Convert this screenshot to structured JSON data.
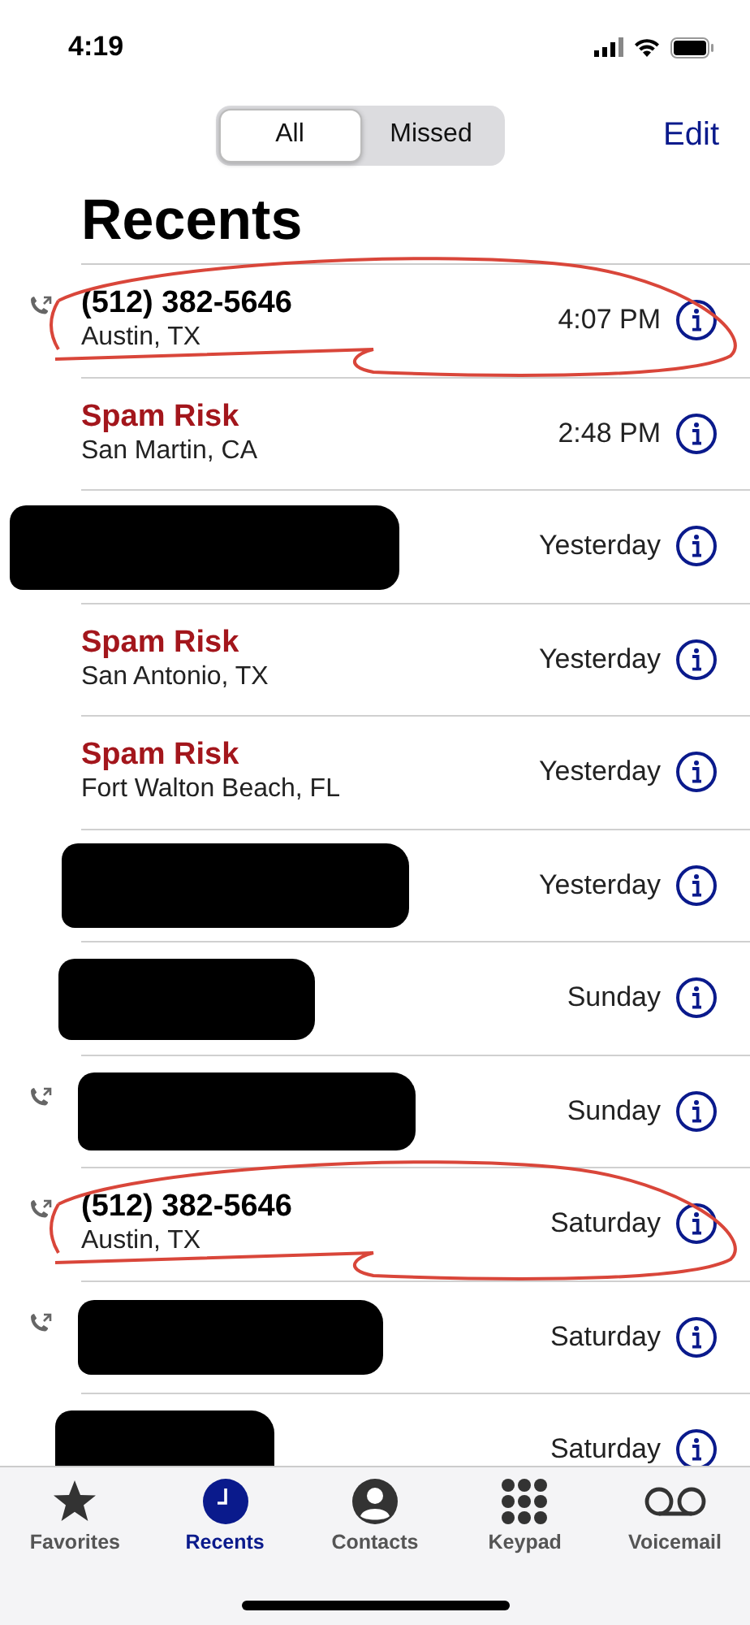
{
  "status_bar": {
    "time": "4:19"
  },
  "nav": {
    "segments": [
      {
        "label": "All",
        "selected": true
      },
      {
        "label": "Missed",
        "selected": false
      }
    ],
    "edit": "Edit"
  },
  "title": "Recents",
  "rows": [
    {
      "outgoing": true,
      "kind": "number",
      "name": "(512) 382-5646",
      "location": "Austin, TX",
      "time": "4:07 PM",
      "redacted": false,
      "circled": true
    },
    {
      "outgoing": false,
      "kind": "spam",
      "name": "Spam Risk",
      "location": "San Martin, CA",
      "time": "2:48 PM",
      "redacted": false,
      "circled": false
    },
    {
      "outgoing": false,
      "kind": "hidden",
      "time": "Yesterday",
      "redacted": true,
      "circled": false
    },
    {
      "outgoing": false,
      "kind": "spam",
      "name": "Spam Risk",
      "location": "San Antonio, TX",
      "time": "Yesterday",
      "redacted": false,
      "circled": false
    },
    {
      "outgoing": false,
      "kind": "spam",
      "name": "Spam Risk",
      "location": "Fort Walton Beach, FL",
      "time": "Yesterday",
      "redacted": false,
      "circled": false
    },
    {
      "outgoing": false,
      "kind": "hidden",
      "time": "Yesterday",
      "redacted": true,
      "circled": false
    },
    {
      "outgoing": false,
      "kind": "hidden",
      "time": "Sunday",
      "redacted": true,
      "circled": false
    },
    {
      "outgoing": true,
      "kind": "hidden",
      "time": "Sunday",
      "redacted": true,
      "circled": false
    },
    {
      "outgoing": true,
      "kind": "number",
      "name": "(512) 382-5646",
      "location": "Austin, TX",
      "time": "Saturday",
      "redacted": false,
      "circled": true
    },
    {
      "outgoing": true,
      "kind": "hidden",
      "time": "Saturday",
      "redacted": true,
      "circled": false
    },
    {
      "outgoing": false,
      "kind": "hidden",
      "time": "Saturday",
      "redacted": true,
      "circled": false
    }
  ],
  "tabs": [
    {
      "label": "Favorites",
      "kind": "star",
      "selected": false
    },
    {
      "label": "Recents",
      "kind": "clock",
      "selected": true
    },
    {
      "label": "Contacts",
      "kind": "person",
      "selected": false
    },
    {
      "label": "Keypad",
      "kind": "keypad",
      "selected": false
    },
    {
      "label": "Voicemail",
      "kind": "voicemail",
      "selected": false
    }
  ]
}
